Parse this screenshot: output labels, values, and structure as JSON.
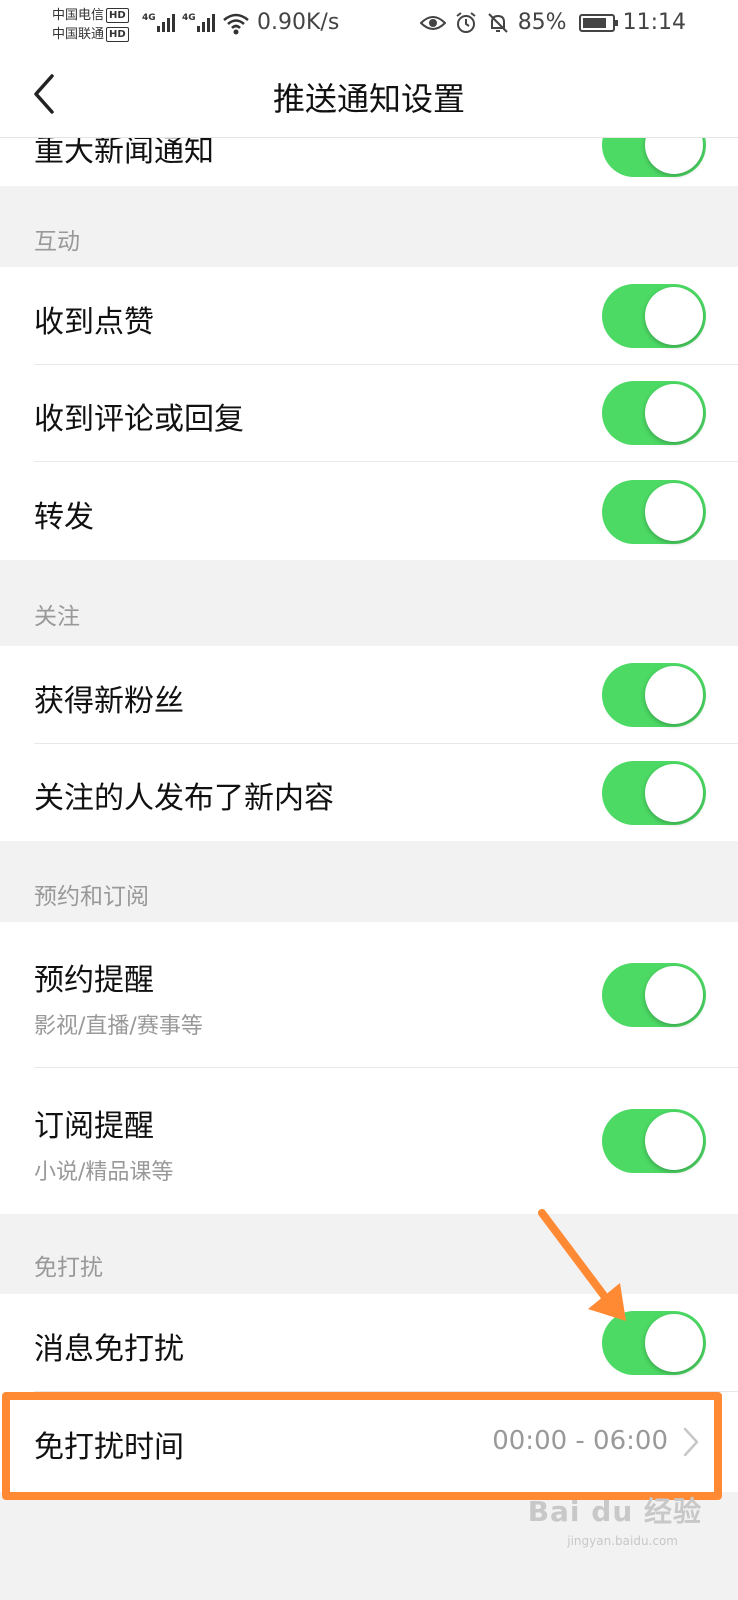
{
  "status_bar": {
    "carrier1": "中国电信",
    "carrier2": "中国联通",
    "hd": "HD",
    "network": "4G",
    "speed": "0.90K/s",
    "battery": "85%",
    "battery_level": 0.85,
    "time": "11:14"
  },
  "header": {
    "title": "推送通知设置"
  },
  "partial_row": {
    "label": "重大新闻通知",
    "toggle_on": true
  },
  "sections": [
    {
      "label": "互动",
      "rows": [
        {
          "label": "收到点赞",
          "toggle_on": true
        },
        {
          "label": "收到评论或回复",
          "toggle_on": true
        },
        {
          "label": "转发",
          "toggle_on": true
        }
      ]
    },
    {
      "label": "关注",
      "rows": [
        {
          "label": "获得新粉丝",
          "toggle_on": true
        },
        {
          "label": "关注的人发布了新内容",
          "toggle_on": true
        }
      ]
    },
    {
      "label": "预约和订阅",
      "rows": [
        {
          "label": "预约提醒",
          "sub": "影视/直播/赛事等",
          "toggle_on": true
        },
        {
          "label": "订阅提醒",
          "sub": "小说/精品课等",
          "toggle_on": true
        }
      ]
    },
    {
      "label": "免打扰",
      "rows": [
        {
          "label": "消息免打扰",
          "toggle_on": true
        },
        {
          "label": "免打扰时间",
          "value": "00:00 - 06:00"
        }
      ]
    }
  ],
  "watermark": {
    "text": "Bai du 经验",
    "sub": "jingyan.baidu.com"
  },
  "colors": {
    "toggle_on": "#4cd964",
    "annotation": "#ff8a33"
  }
}
